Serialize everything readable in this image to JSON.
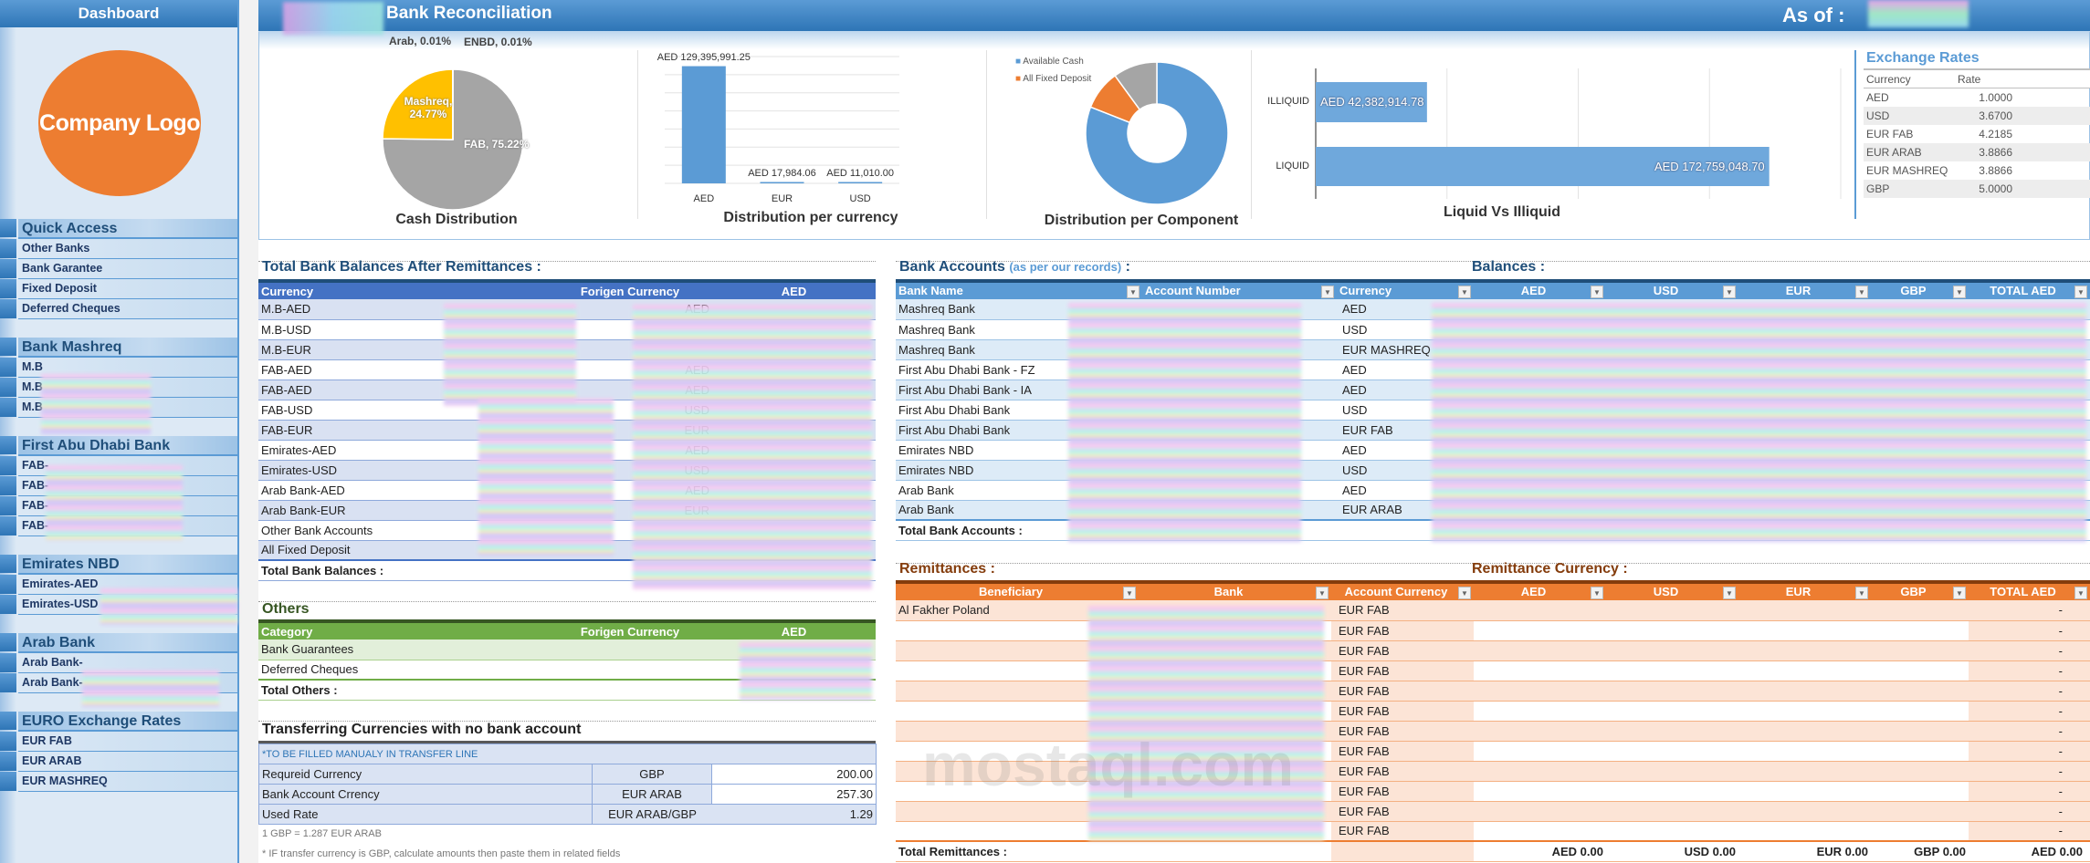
{
  "sidebar": {
    "title": "Dashboard",
    "logo_text": "Company Logo",
    "groups": [
      {
        "title": "Quick Access",
        "items": [
          "Other Banks",
          "Bank Garantee",
          "Fixed Deposit",
          "Deferred Cheques"
        ]
      },
      {
        "title": "Bank Mashreq",
        "items": [
          "M.B",
          "M.B",
          "M.B"
        ]
      },
      {
        "title": "First Abu Dhabi Bank",
        "items": [
          "FAB-",
          "FAB-",
          "FAB-",
          "FAB-"
        ]
      },
      {
        "title": "Emirates NBD",
        "items": [
          "Emirates-AED",
          "Emirates-USD"
        ]
      },
      {
        "title": "Arab Bank",
        "items": [
          "Arab Bank-",
          "Arab Bank-"
        ]
      },
      {
        "title": "EURO Exchange Rates",
        "items": [
          "EUR FAB",
          "EUR ARAB",
          "EUR MASHREQ"
        ]
      }
    ]
  },
  "header": {
    "title": "Bank Reconciliation",
    "as_of_label": "As of :"
  },
  "chart_data": [
    {
      "type": "pie",
      "title": "Cash Distribution",
      "categories": [
        "FAB",
        "Mashreq",
        "Arab",
        "ENBD"
      ],
      "values": [
        75.22,
        24.77,
        0.01,
        0.01
      ],
      "labels": [
        "FAB, 75.22%",
        "Mashreq, 24.77%",
        "Arab, 0.01%",
        "ENBD, 0.01%"
      ],
      "colors": [
        "#a5a5a5",
        "#ffc000",
        "#4472c4",
        "#5b9bd5"
      ]
    },
    {
      "type": "bar",
      "title": "Distribution per currency",
      "categories": [
        "AED",
        "EUR",
        "USD"
      ],
      "values": [
        129395991.25,
        17984.06,
        11010.0
      ],
      "data_labels": [
        "AED 129,395,991.25",
        "AED 17,984.06",
        "AED 11,010.00"
      ],
      "ylim": [
        0,
        140000000
      ],
      "grid": true,
      "color": "#5b9bd5"
    },
    {
      "type": "pie",
      "variant": "donut",
      "title": "Distribution per Component",
      "legend": [
        "Available Cash",
        "All Fixed Deposit"
      ],
      "legend_position": "top-left",
      "values": [
        81,
        9,
        10
      ],
      "colors": [
        "#5b9bd5",
        "#ed7d31",
        "#a5a5a5"
      ]
    },
    {
      "type": "bar",
      "orientation": "horizontal",
      "title": "Liquid Vs Illiquid",
      "categories": [
        "ILLIQUID",
        "LIQUID"
      ],
      "values": [
        42382914.78,
        172759048.7
      ],
      "data_labels": [
        "AED 42,382,914.78",
        "AED 172,759,048.70"
      ],
      "xlim": [
        0,
        200000000
      ],
      "grid": true,
      "color": "#6fa8dc"
    }
  ],
  "exchange_rates": {
    "title": "Exchange Rates",
    "headers": [
      "Currency",
      "Rate"
    ],
    "rows": [
      [
        "AED",
        "1.0000"
      ],
      [
        "USD",
        "3.6700"
      ],
      [
        "EUR FAB",
        "4.2185"
      ],
      [
        "EUR ARAB",
        "3.8866"
      ],
      [
        "EUR MASHREQ",
        "3.8866"
      ],
      [
        "GBP",
        "5.0000"
      ]
    ]
  },
  "total_balances": {
    "title": "Total Bank Balances After Remittances :",
    "headers": [
      "Currency",
      "Forigen Currency",
      "AED"
    ],
    "rows": [
      [
        "M.B-AED",
        "AED"
      ],
      [
        "M.B-USD",
        ""
      ],
      [
        "M.B-EUR",
        ""
      ],
      [
        "FAB-AED",
        "AED"
      ],
      [
        "FAB-AED",
        "AED"
      ],
      [
        "FAB-USD",
        "USD"
      ],
      [
        "FAB-EUR",
        "EUR"
      ],
      [
        "Emirates-AED",
        "AED"
      ],
      [
        "Emirates-USD",
        "USD"
      ],
      [
        "Arab Bank-AED",
        "AED"
      ],
      [
        "Arab Bank-EUR",
        "EUR"
      ],
      [
        "Other Bank Accounts",
        ""
      ],
      [
        "All Fixed Deposit",
        ""
      ]
    ],
    "total_label": "Total Bank Balances :"
  },
  "others": {
    "title": "Others",
    "headers": [
      "Category",
      "Forigen Currency",
      "AED"
    ],
    "rows": [
      "Bank Guarantees",
      "Deferred Cheques"
    ],
    "total_label": "Total Others :"
  },
  "transfer": {
    "title": "Transferring Currencies with no bank account",
    "note": "*TO BE FILLED MANUALY IN TRANSFER LINE",
    "rows": [
      [
        "Requreid Currency",
        "GBP",
        "200.00"
      ],
      [
        "Bank Account Crrency",
        "EUR ARAB",
        "257.30"
      ],
      [
        "Used Rate",
        "EUR ARAB/GBP",
        "1.29"
      ]
    ],
    "footnote1": "1 GBP = 1.287 EUR ARAB",
    "footnote2": "* IF transfer currency is GBP, calculate amounts then paste them in related fields"
  },
  "bank_accounts": {
    "title": "Bank Accounts",
    "title_note": "(as per our records)",
    "title_colon": " :",
    "balances_title": "Balances :",
    "headers": [
      "Bank Name",
      "Account Number",
      "Currency",
      "AED",
      "USD",
      "EUR",
      "GBP",
      "TOTAL AED"
    ],
    "rows": [
      [
        "Mashreq Bank",
        "AED"
      ],
      [
        "Mashreq Bank",
        "USD"
      ],
      [
        "Mashreq Bank",
        "EUR MASHREQ"
      ],
      [
        "First Abu Dhabi Bank - FZ",
        "AED"
      ],
      [
        "First Abu Dhabi Bank - IA",
        "AED"
      ],
      [
        "First Abu Dhabi Bank",
        "USD"
      ],
      [
        "First Abu Dhabi Bank",
        "EUR FAB"
      ],
      [
        "Emirates NBD",
        "AED"
      ],
      [
        "Emirates NBD",
        "USD"
      ],
      [
        "Arab Bank",
        "AED"
      ],
      [
        "Arab Bank",
        "EUR ARAB"
      ]
    ],
    "total_label": "Total Bank Accounts :"
  },
  "remittances": {
    "title": "Remittances :",
    "currency_title": "Remittance Currency :",
    "headers": [
      "Beneficiary",
      "Bank",
      "Account Currency",
      "AED",
      "USD",
      "EUR",
      "GBP",
      "TOTAL AED"
    ],
    "rows": [
      [
        "Al Fakher Poland",
        "EUR FAB",
        "-"
      ],
      [
        "",
        "EUR FAB",
        "-"
      ],
      [
        "",
        "EUR FAB",
        "-"
      ],
      [
        "",
        "EUR FAB",
        "-"
      ],
      [
        "",
        "EUR FAB",
        "-"
      ],
      [
        "",
        "EUR FAB",
        "-"
      ],
      [
        "",
        "EUR FAB",
        "-"
      ],
      [
        "",
        "EUR FAB",
        "-"
      ],
      [
        "",
        "EUR FAB",
        "-"
      ],
      [
        "",
        "EUR FAB",
        "-"
      ],
      [
        "",
        "EUR FAB",
        "-"
      ],
      [
        "",
        "EUR FAB",
        "-"
      ]
    ],
    "total_label": "Total Remittances :",
    "totals": [
      "AED 0.00",
      "USD 0.00",
      "EUR 0.00",
      "GBP 0.00",
      "AED 0.00"
    ]
  },
  "watermark": "mostaql.com"
}
